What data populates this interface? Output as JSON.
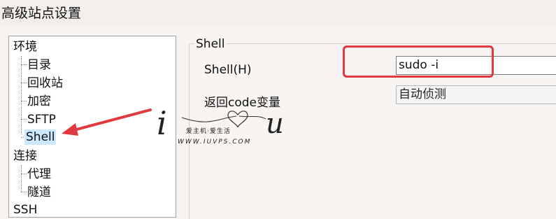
{
  "window": {
    "title": "高级站点设置"
  },
  "tree": {
    "environment": "环境",
    "items_env": [
      "目录",
      "回收站",
      "加密",
      "SFTP",
      "Shell"
    ],
    "connection": "连接",
    "items_conn": [
      "代理",
      "隧道"
    ],
    "ssh": "SSH"
  },
  "shell_group": {
    "title": "Shell",
    "shell_label": "Shell(H)",
    "shell_value": "sudo -i",
    "return_label": "返回code变量",
    "return_value": "自动侦测"
  },
  "watermark": {
    "line1": "爱主机·爱生活",
    "line2": "WWW.IUVPS.COM"
  },
  "colors": {
    "highlight": "#e0393e",
    "selection": "#cce8ff"
  }
}
